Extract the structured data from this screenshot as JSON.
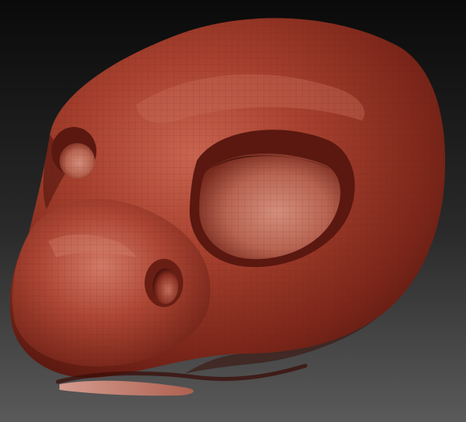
{
  "viewport": {
    "background_top": "#0a0a0a",
    "background_bottom": "#5a5a5a"
  },
  "model": {
    "material_base": "#a8412f",
    "material_highlight": "#d77a64",
    "material_shadow": "#4a130c",
    "wireframe_color": "#5b1a10",
    "icon_name": "sculpted-head-icon"
  }
}
